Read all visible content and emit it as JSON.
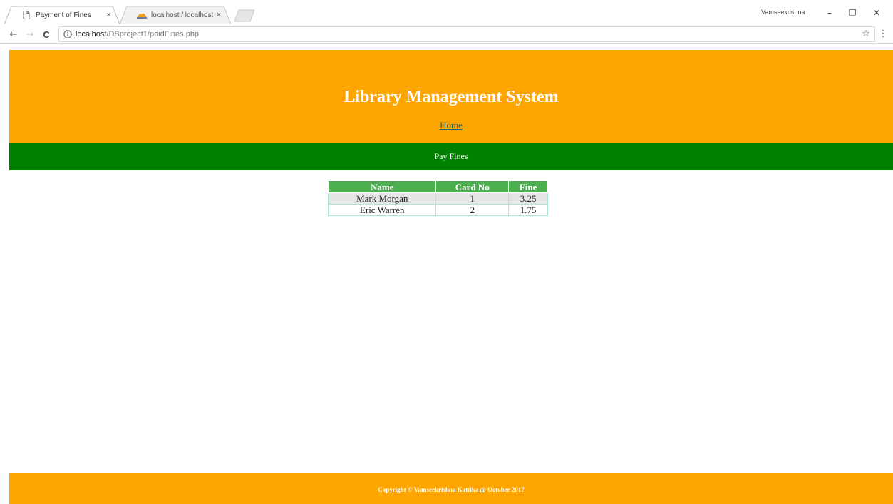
{
  "browser": {
    "tabs": [
      {
        "title": "Payment of Fines",
        "close": "×",
        "icon": "page-icon"
      },
      {
        "title": "localhost / localhost / lib",
        "close": "×",
        "icon": "phpmyadmin-icon"
      }
    ],
    "profile_name": "Vamseekrishna",
    "window_controls": {
      "minimize": "–",
      "restore": "❐",
      "close": "✕"
    },
    "nav": {
      "back": "←",
      "forward": "→",
      "reload": "C"
    },
    "address": {
      "host": "localhost",
      "path": "/DBproject1/paidFines.php"
    },
    "bookmark_icon": "☆",
    "menu_icon": "⋮"
  },
  "page": {
    "site_title": "Library Management System",
    "home_link": "Home",
    "nav_label": "Pay Fines",
    "table": {
      "headers": [
        "Name",
        "Card No",
        "Fine"
      ],
      "rows": [
        {
          "name": "Mark Morgan",
          "card_no": "1",
          "fine": "3.25"
        },
        {
          "name": "Eric Warren",
          "card_no": "2",
          "fine": "1.75"
        }
      ]
    },
    "footer": "Copyright © Vamseekrishna Kattika @ October 2017"
  },
  "colors": {
    "header_bg": "#ffa500",
    "nav_bg": "#008000",
    "table_header_bg": "#4caf50",
    "footer_bg": "#ffa500"
  }
}
